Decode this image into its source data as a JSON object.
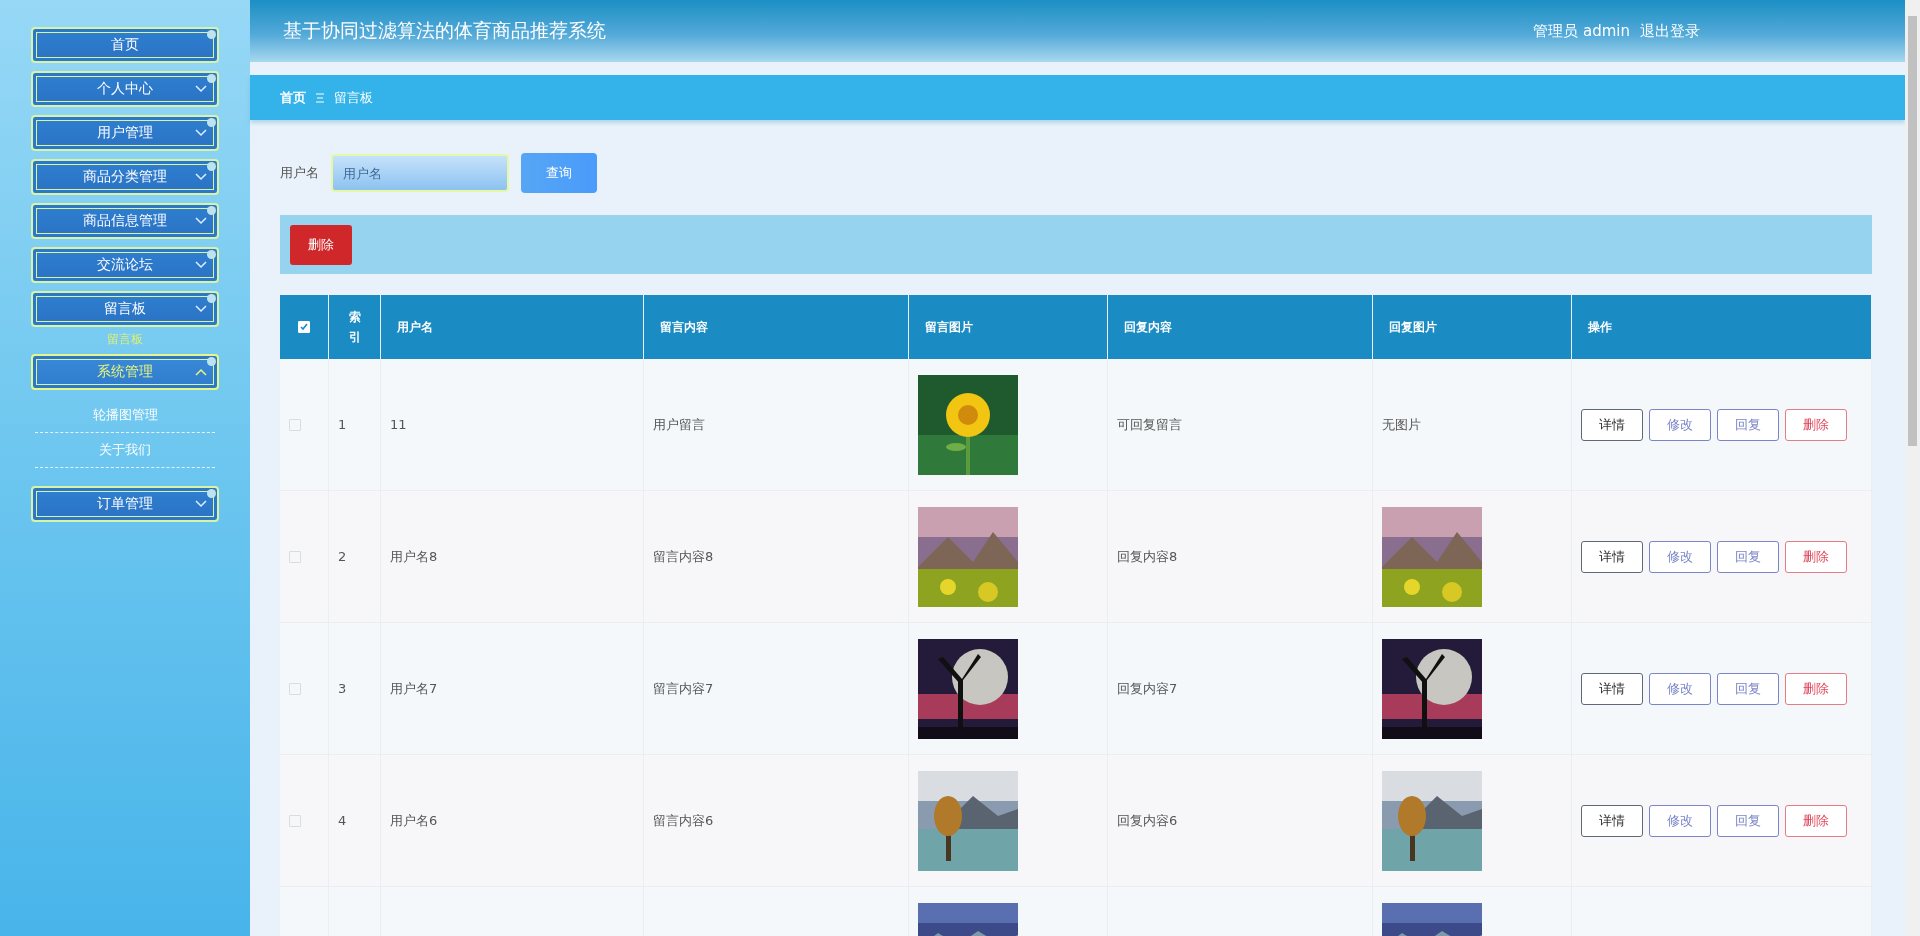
{
  "sidebar": {
    "items": [
      {
        "label": "首页",
        "kind": "link",
        "selected": false
      },
      {
        "label": "个人中心",
        "kind": "menu",
        "selected": false,
        "expanded": false
      },
      {
        "label": "用户管理",
        "kind": "menu",
        "selected": false,
        "expanded": false
      },
      {
        "label": "商品分类管理",
        "kind": "menu",
        "selected": false,
        "expanded": false
      },
      {
        "label": "商品信息管理",
        "kind": "menu",
        "selected": false,
        "expanded": false
      },
      {
        "label": "交流论坛",
        "kind": "menu",
        "selected": false,
        "expanded": false
      },
      {
        "label": "留言板",
        "kind": "menu",
        "selected": false,
        "expanded": false
      },
      {
        "label": "留言板",
        "kind": "ghost"
      },
      {
        "label": "系统管理",
        "kind": "menu",
        "selected": true,
        "expanded": true,
        "children": [
          {
            "label": "轮播图管理"
          },
          {
            "label": "关于我们"
          }
        ]
      },
      {
        "label": "订单管理",
        "kind": "menu",
        "selected": false,
        "expanded": false
      }
    ]
  },
  "header": {
    "title": "基于协同过滤算法的体育商品推荐系统",
    "user": "管理员 admin",
    "logout": "退出登录"
  },
  "breadcrumb": [
    "首页",
    "留言板"
  ],
  "filter": {
    "label": "用户名",
    "placeholder": "用户名",
    "button": "查询"
  },
  "actions": [
    "删除"
  ],
  "table": {
    "columns": [
      "",
      "索引",
      "用户名",
      "留言内容",
      "留言图片",
      "回复内容",
      "回复图片",
      "操作"
    ],
    "header_checked": true,
    "rows": [
      {
        "checked": false,
        "index": "1",
        "username": "11",
        "content": "用户留言",
        "image": {
          "kind": "picture"
        },
        "reply": "可回复留言",
        "reply_image": {
          "kind": "text",
          "text": "无图片"
        },
        "buttons": [
          {
            "label": "详情",
            "kind": "detail"
          },
          {
            "label": "修改",
            "kind": "edit"
          },
          {
            "label": "回复",
            "kind": "edit"
          },
          {
            "label": "删除",
            "kind": "delete"
          }
        ]
      },
      {
        "checked": false,
        "index": "2",
        "username": "用户名8",
        "content": "留言内容8",
        "image": {
          "kind": "picture"
        },
        "reply": "回复内容8",
        "reply_image": {
          "kind": "picture"
        },
        "buttons": [
          {
            "label": "详情",
            "kind": "detail"
          },
          {
            "label": "修改",
            "kind": "edit"
          },
          {
            "label": "回复",
            "kind": "edit"
          },
          {
            "label": "删除",
            "kind": "delete"
          }
        ]
      },
      {
        "checked": false,
        "index": "3",
        "username": "用户名7",
        "content": "留言内容7",
        "image": {
          "kind": "picture"
        },
        "reply": "回复内容7",
        "reply_image": {
          "kind": "picture"
        },
        "buttons": [
          {
            "label": "详情",
            "kind": "detail"
          },
          {
            "label": "修改",
            "kind": "edit"
          },
          {
            "label": "回复",
            "kind": "edit"
          },
          {
            "label": "删除",
            "kind": "delete"
          }
        ]
      },
      {
        "checked": false,
        "index": "4",
        "username": "用户名6",
        "content": "留言内容6",
        "image": {
          "kind": "picture"
        },
        "reply": "回复内容6",
        "reply_image": {
          "kind": "picture"
        },
        "buttons": [
          {
            "label": "详情",
            "kind": "detail"
          },
          {
            "label": "修改",
            "kind": "edit"
          },
          {
            "label": "回复",
            "kind": "edit"
          },
          {
            "label": "删除",
            "kind": "delete"
          }
        ]
      },
      {
        "image": {
          "kind": "picture"
        },
        "reply_image": {
          "kind": "picture"
        }
      }
    ]
  }
}
